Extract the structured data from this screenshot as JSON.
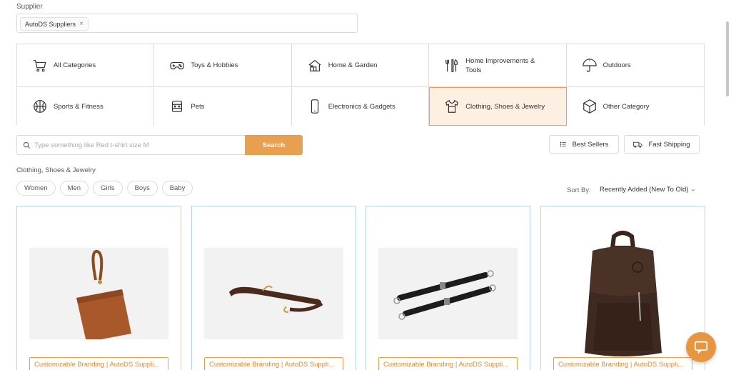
{
  "supplier": {
    "label": "Supplier",
    "selected_chip": "AutoDS Suppliers",
    "chip_remove": "×"
  },
  "categories": [
    {
      "label": "All Categories",
      "icon": "cart-icon"
    },
    {
      "label": "Toys & Hobbies",
      "icon": "gamepad-icon"
    },
    {
      "label": "Home & Garden",
      "icon": "house-icon"
    },
    {
      "label": "Home Improvements & Tools",
      "icon": "tools-icon"
    },
    {
      "label": "Outdoors",
      "icon": "umbrella-icon"
    },
    {
      "label": "Sports & Fitness",
      "icon": "ball-icon"
    },
    {
      "label": "Pets",
      "icon": "pet-icon"
    },
    {
      "label": "Electronics & Gadgets",
      "icon": "phone-icon"
    },
    {
      "label": "Clothing, Shoes & Jewelry",
      "icon": "tshirt-icon",
      "active": true
    },
    {
      "label": "Other Category",
      "icon": "box-icon"
    }
  ],
  "search": {
    "placeholder": "Type something like Red t-shirt size M",
    "value": "",
    "button_label": "Search"
  },
  "filters": {
    "best_sellers": "Best Sellers",
    "fast_shipping": "Fast Shipping"
  },
  "subcategory_title": "Clothing, Shoes & Jewelry",
  "subcategories": [
    "Women",
    "Men",
    "Girls",
    "Boys",
    "Baby"
  ],
  "sort": {
    "label": "Sort By:",
    "value": "Recently Added (New To Old)"
  },
  "products": [
    {
      "tag": "Customizable Branding | AutoDS Suppli...",
      "image": "leather-wristlet-pouch"
    },
    {
      "tag": "Customizable Branding | AutoDS Suppli...",
      "image": "leather-strap-brown"
    },
    {
      "tag": "Customizable Branding | AutoDS Suppli...",
      "image": "leather-strap-black"
    },
    {
      "tag": "Customizable Branding | AutoDS Suppli...",
      "image": "leather-backpack"
    }
  ],
  "colors": {
    "accent": "#e8a050",
    "active_bg": "#fdefe2",
    "card_border": "#b9d3ee"
  }
}
